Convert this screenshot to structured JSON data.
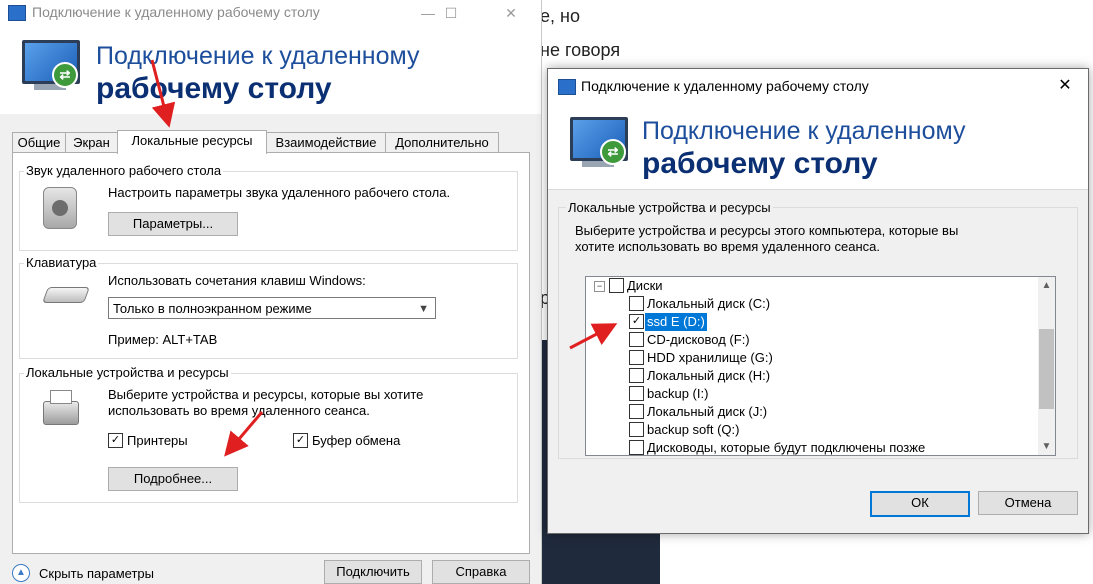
{
  "background_doc": {
    "line1": "е, но",
    "line2": "не говоря",
    "fragment": "р"
  },
  "left_dialog": {
    "window_title": "Подключение к удаленному рабочему столу",
    "banner_line1": "Подключение к удаленному",
    "banner_line2": "рабочему столу",
    "tabs": [
      {
        "label": "Общие"
      },
      {
        "label": "Экран"
      },
      {
        "label": "Локальные ресурсы",
        "active": true
      },
      {
        "label": "Взаимодействие"
      },
      {
        "label": "Дополнительно"
      }
    ],
    "sound": {
      "group_title": "Звук удаленного рабочего стола",
      "description": "Настроить параметры звука удаленного рабочего стола.",
      "button": "Параметры..."
    },
    "keyboard": {
      "group_title": "Клавиатура",
      "description": "Использовать сочетания клавиш Windows:",
      "select_value": "Только в полноэкранном режиме",
      "example": "Пример: ALT+TAB"
    },
    "local_devices": {
      "group_title": "Локальные устройства и ресурсы",
      "description_line1": "Выберите устройства и ресурсы, которые вы хотите",
      "description_line2": "использовать во время удаленного сеанса.",
      "printers_label": "Принтеры",
      "printers_checked": true,
      "clipboard_label": "Буфер обмена",
      "clipboard_checked": true,
      "more_button": "Подробнее..."
    },
    "footer": {
      "hide_options": "Скрыть параметры",
      "connect_button": "Подключить",
      "help_button": "Справка"
    }
  },
  "right_dialog": {
    "window_title": "Подключение к удаленному рабочему столу",
    "close_symbol": "✕",
    "banner_line1": "Подключение к удаленному",
    "banner_line2": "рабочему столу",
    "group_title": "Локальные устройства и ресурсы",
    "description_line1": "Выберите устройства и ресурсы этого компьютера, которые вы",
    "description_line2": "хотите использовать во время удаленного сеанса.",
    "tree": {
      "root_label": "Диски",
      "root_expander": "−",
      "items": [
        {
          "label": "Локальный диск (C:)",
          "checked": false
        },
        {
          "label": "ssd E (D:)",
          "checked": true,
          "selected": true
        },
        {
          "label": "CD-дисковод (F:)",
          "checked": false
        },
        {
          "label": "HDD хранилище (G:)",
          "checked": false
        },
        {
          "label": "Локальный диск (H:)",
          "checked": false
        },
        {
          "label": "backup (I:)",
          "checked": false
        },
        {
          "label": "Локальный диск (J:)",
          "checked": false
        },
        {
          "label": "backup soft (Q:)",
          "checked": false
        },
        {
          "label": "Дисководы, которые будут подключены позже",
          "checked": false
        }
      ]
    },
    "ok_button": "ОК",
    "cancel_button": "Отмена"
  },
  "colors": {
    "banner_blue": "#1d4e9c",
    "selection_blue": "#0078d7",
    "annotation_red": "#e02020"
  }
}
